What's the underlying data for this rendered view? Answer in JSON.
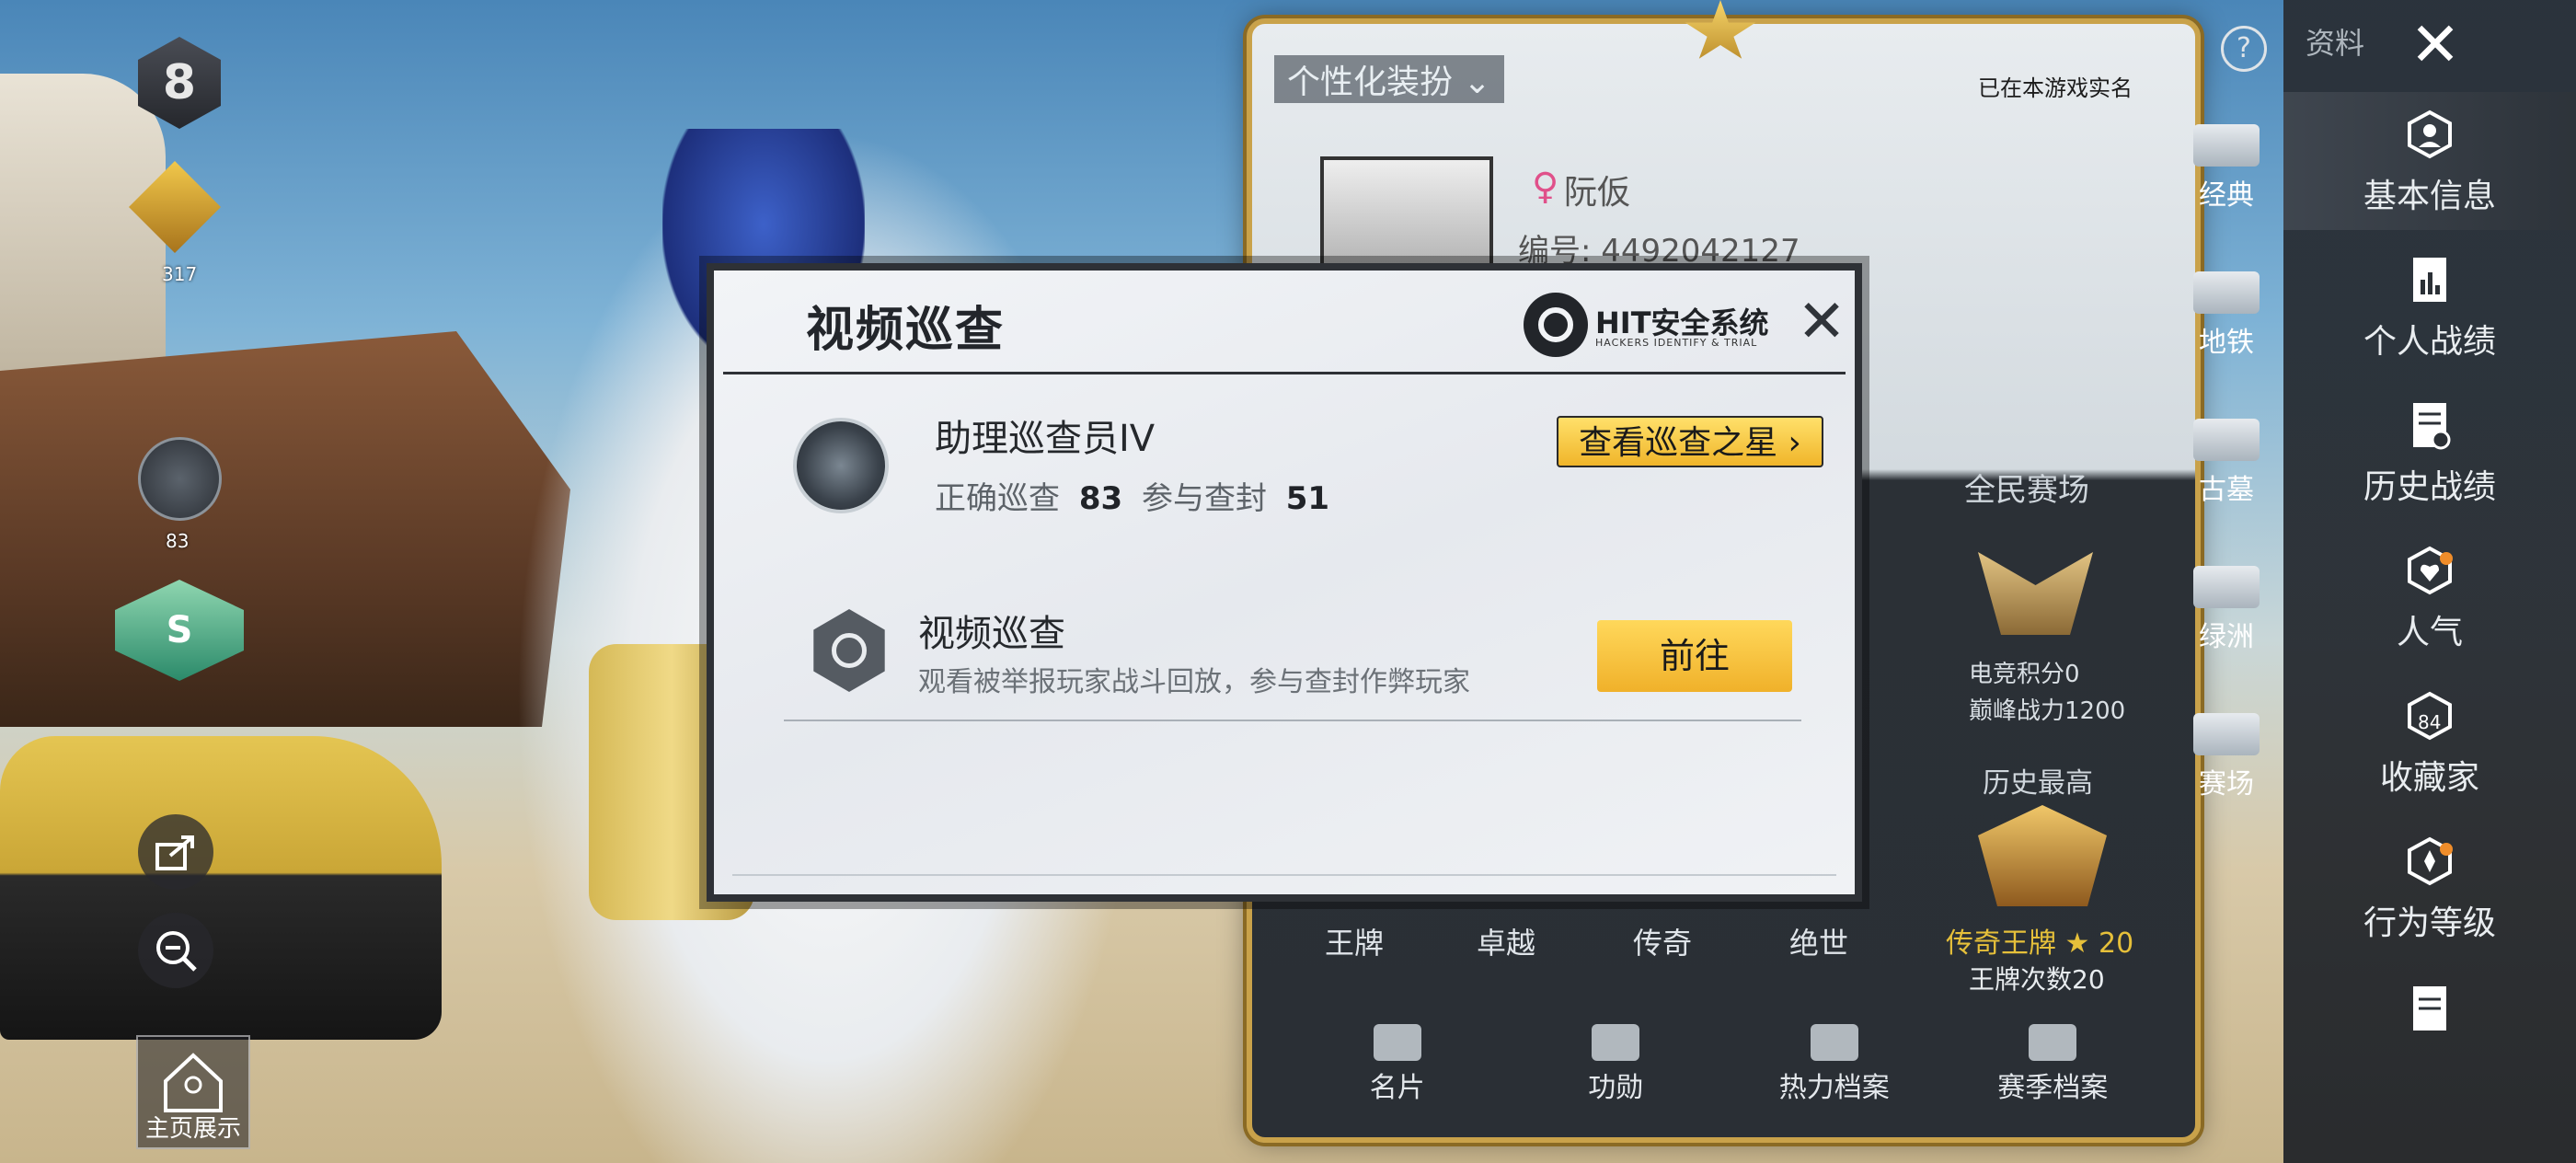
{
  "hud": {
    "season_number": "8",
    "tier_badge_number": "317",
    "weapon_level": "83",
    "s_badge": "S",
    "home_label": "主页展示"
  },
  "profile": {
    "decoration_label": "个性化装扮",
    "real_name_note": "已在本游戏实名",
    "player_name": "阮仮",
    "player_id": "编号: 4492042127",
    "arena_title": "全民赛场",
    "arena_score": "电竞积分0",
    "arena_power": "巅峰战力1200",
    "history_title": "历史最高",
    "history_rank": "传奇王牌",
    "history_stars": "20",
    "history_count": "王牌次数20",
    "tiers": [
      "王牌",
      "卓越",
      "传奇",
      "绝世"
    ],
    "bottom_tabs": [
      "名片",
      "功勋",
      "热力档案",
      "赛季档案"
    ]
  },
  "maps": [
    "经典",
    "地铁",
    "古墓",
    "绿洲",
    "赛场"
  ],
  "sidebar": {
    "resource_label": "资料",
    "items": [
      "基本信息",
      "个人战绩",
      "历史战绩",
      "人气",
      "收藏家",
      "行为等级"
    ],
    "collector_badge": "84"
  },
  "modal": {
    "title": "视频巡查",
    "system_name": "HIT安全系统",
    "system_sub": "HACKERS IDENTIFY & TRIAL",
    "rank_name": "助理巡查员IV",
    "stat_correct_label": "正确巡查",
    "stat_correct_value": "83",
    "stat_ban_label": "参与查封",
    "stat_ban_value": "51",
    "star_button": "查看巡查之星",
    "task_name": "视频巡查",
    "task_desc": "观看被举报玩家战斗回放，参与查封作弊玩家",
    "go_button": "前往"
  }
}
